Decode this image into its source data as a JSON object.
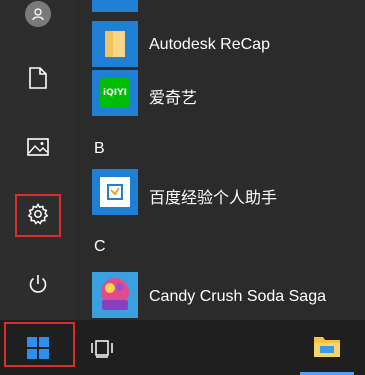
{
  "left_rail": {
    "items": [
      {
        "icon": "user-avatar-icon"
      },
      {
        "icon": "document-icon"
      },
      {
        "icon": "pictures-icon"
      },
      {
        "icon": "settings-gear-icon",
        "highlighted": true
      },
      {
        "icon": "power-icon"
      }
    ]
  },
  "app_list": {
    "apps": [
      {
        "label": "Autodesk ReCap",
        "icon": "folder-icon"
      },
      {
        "label": "爱奇艺",
        "icon": "iqiyi-icon"
      },
      {
        "label": "百度经验个人助手",
        "icon": "baidu-jingyan-icon"
      },
      {
        "label": "Candy Crush Soda Saga",
        "icon": "candy-crush-soda-icon"
      }
    ],
    "section_letters": [
      "B",
      "C"
    ]
  },
  "taskbar": {
    "items": [
      {
        "icon": "windows-start-icon",
        "highlighted": true
      },
      {
        "icon": "task-view-icon"
      },
      {
        "icon": "file-explorer-icon"
      }
    ]
  },
  "colors": {
    "rail_bg": "#2d2d2d",
    "list_bg": "#2b2b2b",
    "taskbar_bg": "#1f1f1f",
    "tile_blue": "#1e7fd4",
    "highlight_red": "#e02b2b",
    "iqiyi_green": "#00be06"
  }
}
